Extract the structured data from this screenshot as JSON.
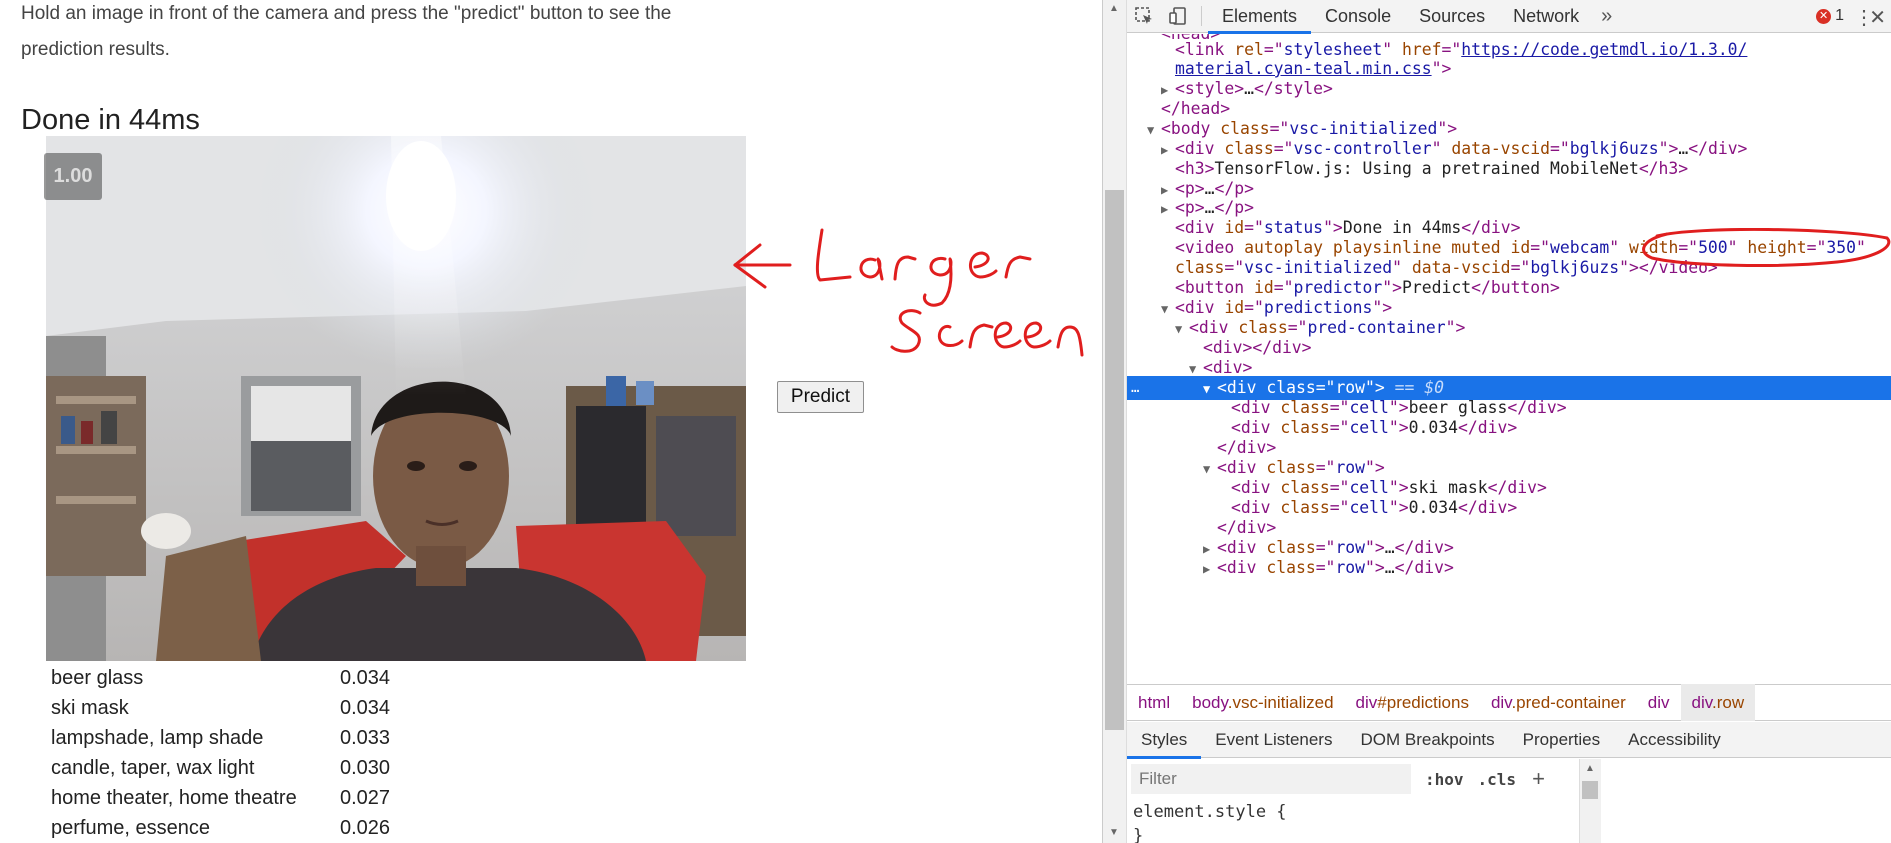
{
  "page": {
    "intro_line1": "Hold an image in front of the camera and press the \"predict\" button to see the",
    "intro_line2": "prediction results.",
    "status": "Done in 44ms",
    "fps": "1.00",
    "predict_label": "Predict",
    "annotation_line1": "Larger",
    "annotation_line2": "Screen",
    "predictions": [
      {
        "label": "beer glass",
        "score": "0.034"
      },
      {
        "label": "ski mask",
        "score": "0.034"
      },
      {
        "label": "lampshade, lamp shade",
        "score": "0.033"
      },
      {
        "label": "candle, taper, wax light",
        "score": "0.030"
      },
      {
        "label": "home theater, home theatre",
        "score": "0.027"
      },
      {
        "label": "perfume, essence",
        "score": "0.026"
      }
    ]
  },
  "devtools": {
    "tabs": [
      "Elements",
      "Console",
      "Sources",
      "Network"
    ],
    "more": "»",
    "error_count": "1",
    "error_symbol": "✕",
    "dom": {
      "l0": "<head>",
      "l1_href": "https://code.getmdl.io/1.3.0/",
      "l1_href2": "material.cyan-teal.min.css",
      "l2": "…",
      "l3": "</head>",
      "body_class": "vsc-initialized",
      "vsc_class": "vsc-controller",
      "vsc_id": "bglkj6uzs",
      "h3_text": "TensorFlow.js: Using a pretrained MobileNet",
      "status_id": "status",
      "status_text": "Done in 44ms",
      "video_id": "webcam",
      "video_width": "500",
      "video_height": "350",
      "video_class": "vsc-initialized",
      "video_vscid": "bglkj6uzs",
      "button_id": "predictor",
      "button_text": "Predict",
      "pred_id": "predictions",
      "container_class": "pred-container",
      "row_class": "row",
      "cell_class": "cell",
      "cell1": "beer glass",
      "cell2": "0.034",
      "cell3": "ski mask",
      "cell4": "0.034",
      "sel_marker": "== $0",
      "dots": "…"
    },
    "breadcrumbs": [
      {
        "tag": "html",
        "rest": ""
      },
      {
        "tag": "body",
        "rest": ".vsc-initialized"
      },
      {
        "tag": "div",
        "rest": "#predictions"
      },
      {
        "tag": "div",
        "rest": ".pred-container"
      },
      {
        "tag": "div",
        "rest": ""
      },
      {
        "tag": "div",
        "rest": ".row"
      }
    ],
    "subtabs": [
      "Styles",
      "Event Listeners",
      "DOM Breakpoints",
      "Properties",
      "Accessibility"
    ],
    "filter_placeholder": "Filter",
    "hov": ":hov",
    "cls": ".cls",
    "plus": "+",
    "element_style": "element.style {",
    "element_style_close": "}"
  },
  "colors": {
    "accent": "#1a73e8",
    "annotation": "#e01e1e",
    "tag": "#881280",
    "attr": "#994500",
    "value": "#1a1aa6"
  }
}
